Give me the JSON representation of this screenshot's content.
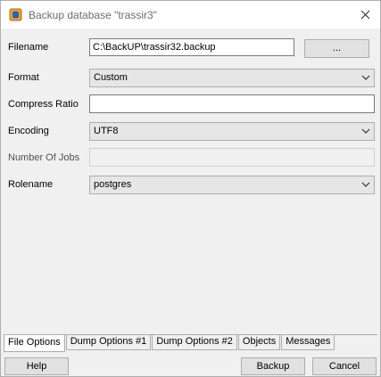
{
  "window": {
    "title": "Backup database \"trassir3\""
  },
  "form": {
    "filename": {
      "label": "Filename",
      "value": "C:\\BackUP\\trassir32.backup"
    },
    "browse_button": "...",
    "format": {
      "label": "Format",
      "value": "Custom"
    },
    "compress_ratio": {
      "label": "Compress Ratio",
      "value": ""
    },
    "encoding": {
      "label": "Encoding",
      "value": "UTF8"
    },
    "number_of_jobs": {
      "label": "Number Of Jobs",
      "value": ""
    },
    "rolename": {
      "label": "Rolename",
      "value": "postgres"
    }
  },
  "tabs": [
    {
      "label": "File Options",
      "active": true
    },
    {
      "label": "Dump Options #1",
      "active": false
    },
    {
      "label": "Dump Options #2",
      "active": false
    },
    {
      "label": "Objects",
      "active": false
    },
    {
      "label": "Messages",
      "active": false
    }
  ],
  "footer": {
    "help": "Help",
    "backup": "Backup",
    "cancel": "Cancel"
  },
  "icons": {
    "app": "database-backup-icon",
    "close": "close-icon",
    "dropdown": "chevron-down-icon"
  },
  "colors": {
    "title_text": "#6d6d6d",
    "app_icon": "#d9822b"
  }
}
